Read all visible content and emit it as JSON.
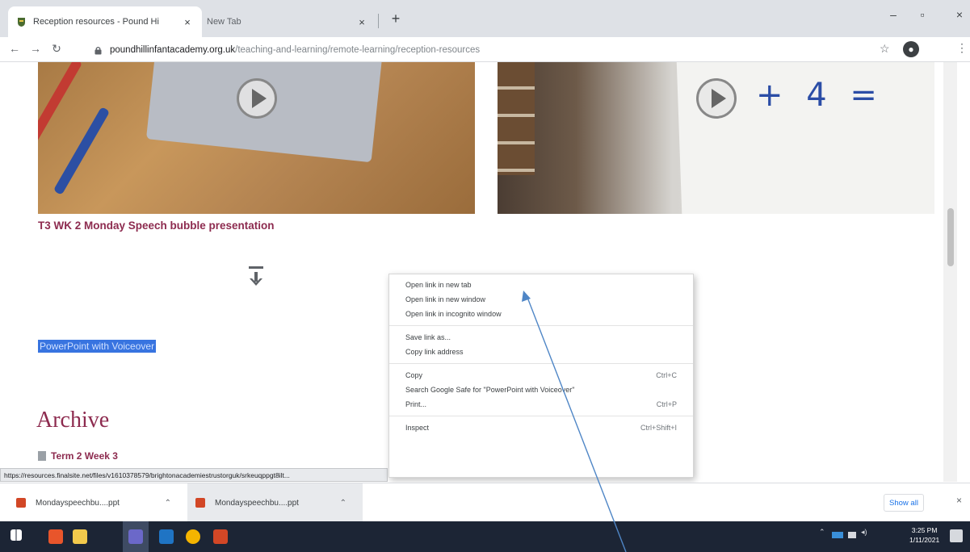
{
  "browser": {
    "tabs": [
      {
        "title": "Reception resources - Pound Hi",
        "active": true
      },
      {
        "title": "New Tab",
        "active": false
      }
    ],
    "new_tab_label": "+",
    "window_controls": {
      "minimize": "–",
      "maximize": "▫",
      "close": "×"
    },
    "url_domain": "poundhillinfantacademy.org.uk",
    "url_path": "/teaching-and-learning/remote-learning/reception-resources",
    "status_url": "https://resources.finalsite.net/files/v1610378579/brightonacademiestrustorguk/srkeuqppgt8ilt..."
  },
  "page": {
    "board_text": "+ 4 =",
    "section_title": "T3 WK 2 Monday Speech bubble presentation",
    "selected_link": "PowerPoint with Voiceover",
    "archive_heading": "Archive",
    "archive_item": "Term 2 Week 3"
  },
  "context_menu": {
    "groups": [
      [
        {
          "label": "Open link in new tab",
          "shortcut": ""
        },
        {
          "label": "Open link in new window",
          "shortcut": ""
        },
        {
          "label": "Open link in incognito window",
          "shortcut": ""
        }
      ],
      [
        {
          "label": "Save link as...",
          "shortcut": ""
        },
        {
          "label": "Copy link address",
          "shortcut": ""
        }
      ],
      [
        {
          "label": "Copy",
          "shortcut": "Ctrl+C"
        },
        {
          "label": "Search Google Safe for \"PowerPoint with Voiceover\"",
          "shortcut": ""
        },
        {
          "label": "Print...",
          "shortcut": "Ctrl+P"
        }
      ],
      [
        {
          "label": "Inspect",
          "shortcut": "Ctrl+Shift+I"
        }
      ]
    ]
  },
  "downloads": {
    "items": [
      {
        "name": "Mondayspeechbu....ppt"
      },
      {
        "name": "Mondayspeechbu....ppt"
      }
    ],
    "show_all": "Show all",
    "close": "×"
  },
  "taskbar": {
    "time": "3:25 PM",
    "date": "1/11/2021"
  },
  "colors": {
    "link_heading": "#8d2b4f",
    "selection": "#3874e0",
    "taskbar": "#1c2535",
    "annotation_arrow": "#4f86c6"
  }
}
